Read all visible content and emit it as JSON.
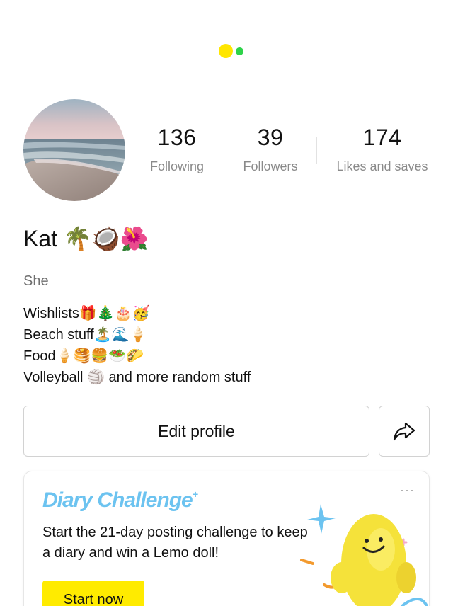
{
  "loader": {
    "colors": {
      "primary": "#ffe600",
      "secondary": "#2ed34a"
    }
  },
  "profile": {
    "avatar_desc": "beach-photo",
    "name": "Kat 🌴🥥🌺",
    "pronoun": "She",
    "bio": [
      "Wishlists🎁🎄🎂🥳",
      "Beach stuff🏝️🌊🍦",
      "Food🍦🥞🍔🥗🌮",
      "Volleyball 🏐 and more random stuff"
    ]
  },
  "stats": {
    "following": {
      "value": "136",
      "label": "Following"
    },
    "followers": {
      "value": "39",
      "label": "Followers"
    },
    "likes": {
      "value": "174",
      "label": "Likes and saves"
    }
  },
  "actions": {
    "edit_label": "Edit profile",
    "share_icon": "share-icon"
  },
  "challenge_card": {
    "title": "Diary Challenge",
    "more_label": "···",
    "description": "Start the 21-day posting challenge to keep a diary and win a Lemo doll!",
    "button_label": "Start now",
    "mascot": "lemo-doll",
    "colors": {
      "title": "#6cc3f0",
      "button": "#ffeb00",
      "mascot": "#f5e23a"
    }
  }
}
